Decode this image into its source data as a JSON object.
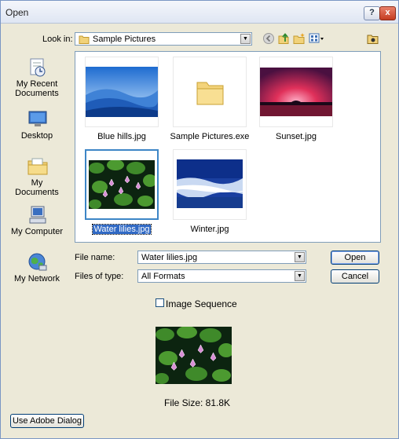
{
  "window": {
    "title": "Open",
    "help_label": "?",
    "close_label": "x"
  },
  "toolbar": {
    "look_in_label": "Look in:",
    "look_in_value": "Sample Pictures",
    "dropdown_glyph": "▼"
  },
  "places": [
    {
      "label": "My Recent Documents",
      "icon": "recent-documents-icon"
    },
    {
      "label": "Desktop",
      "icon": "desktop-icon"
    },
    {
      "label": "My Documents",
      "icon": "my-documents-icon"
    },
    {
      "label": "My Computer",
      "icon": "my-computer-icon"
    },
    {
      "label": "My Network",
      "icon": "my-network-icon"
    }
  ],
  "files": [
    {
      "name": "Blue hills.jpg",
      "selected": false
    },
    {
      "name": "Sample Pictures.exe",
      "selected": false
    },
    {
      "name": "Sunset.jpg",
      "selected": false
    },
    {
      "name": "Water lilies.jpg",
      "selected": true
    },
    {
      "name": "Winter.jpg",
      "selected": false
    }
  ],
  "form": {
    "file_name_label": "File name:",
    "file_name_value": "Water lilies.jpg",
    "file_type_label": "Files of type:",
    "file_type_value": "All Formats",
    "open_label": "Open",
    "cancel_label": "Cancel",
    "image_sequence_label": "Image Sequence",
    "file_size": "File Size: 81.8K",
    "adobe_dialog_label": "Use Adobe Dialog"
  },
  "colors": {
    "selection": "#316ac5",
    "dialog_bg": "#ece9d8",
    "border": "#7f9db9"
  }
}
